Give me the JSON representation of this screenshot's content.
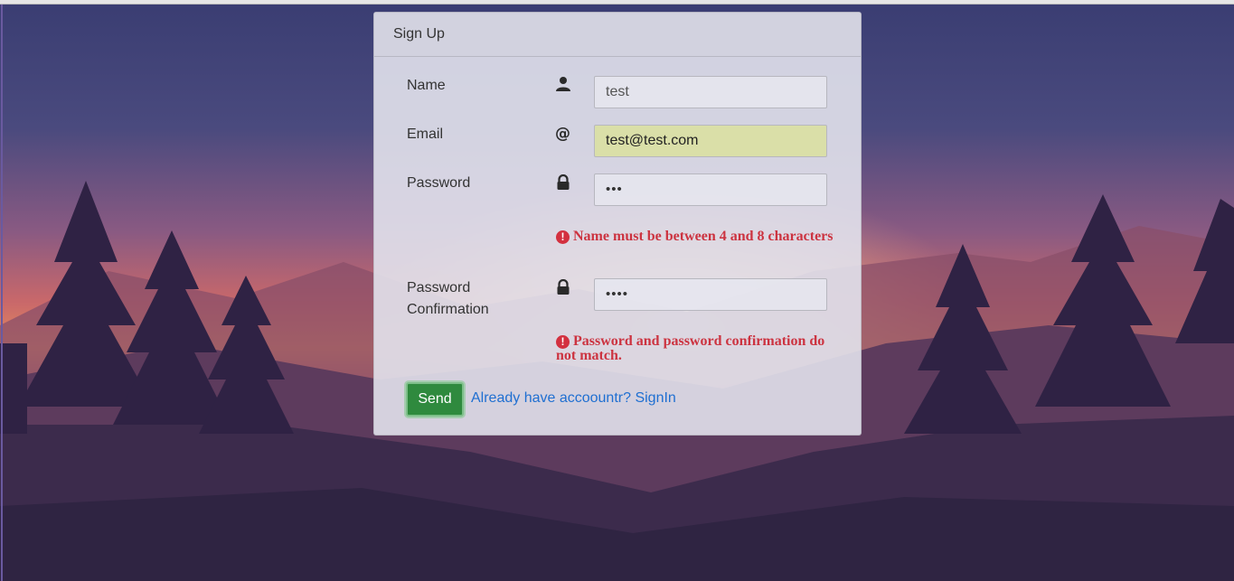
{
  "form": {
    "title": "Sign Up",
    "name_label": "Name",
    "name_value": "test",
    "email_label": "Email",
    "email_value": "test@test.com",
    "password_label": "Password",
    "password_value": "•••",
    "password_error": "Name must be between 4 and 8 characters",
    "confirm_label": "Password Confirmation",
    "confirm_value": "••••",
    "confirm_error": "Password and password confirmation do not match.",
    "send_label": "Send",
    "signin_link": "Already have accoountr? SignIn"
  },
  "icons": {
    "name": "user-icon",
    "email": "at-icon",
    "password": "lock-icon",
    "confirm": "lock-icon",
    "error": "exclamation-circle-icon"
  },
  "colors": {
    "send_button": "#2f8a3e",
    "error_text": "#cc3340",
    "link": "#1f6fd1",
    "autofill": "#dadfa8"
  }
}
